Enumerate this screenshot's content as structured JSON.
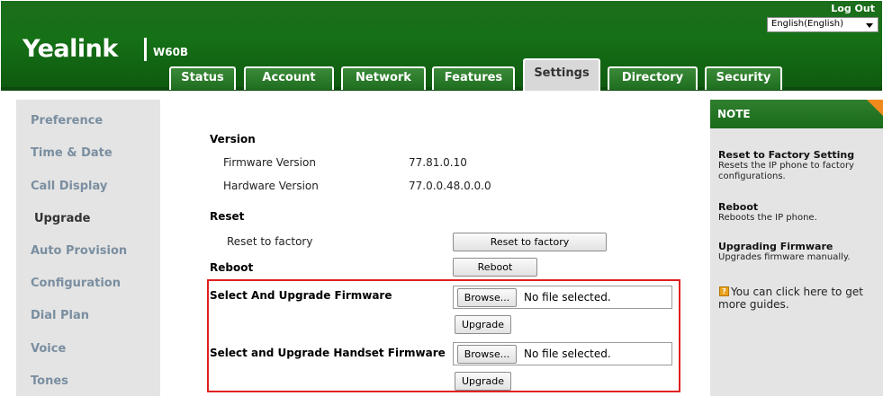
{
  "header": {
    "logo": "Yealink",
    "model": "W60B",
    "logout": "Log Out",
    "language": "English(English)"
  },
  "tabs": [
    {
      "label": "Status"
    },
    {
      "label": "Account"
    },
    {
      "label": "Network"
    },
    {
      "label": "Features"
    },
    {
      "label": "Settings"
    },
    {
      "label": "Directory"
    },
    {
      "label": "Security"
    }
  ],
  "active_tab": "Settings",
  "sidebar": {
    "items": [
      {
        "label": "Preference"
      },
      {
        "label": "Time & Date"
      },
      {
        "label": "Call Display"
      },
      {
        "label": "Upgrade"
      },
      {
        "label": "Auto Provision"
      },
      {
        "label": "Configuration"
      },
      {
        "label": "Dial Plan"
      },
      {
        "label": "Voice"
      },
      {
        "label": "Tones"
      }
    ],
    "active": "Upgrade"
  },
  "main": {
    "version_title": "Version",
    "firmware_label": "Firmware Version",
    "firmware_value": "77.81.0.10",
    "hardware_label": "Hardware Version",
    "hardware_value": "77.0.0.48.0.0.0",
    "reset_title": "Reset",
    "reset_label": "Reset to factory",
    "reset_button": "Reset to factory",
    "reboot_title": "Reboot",
    "reboot_button": "Reboot",
    "fw_title": "Select And Upgrade Firmware",
    "fw_browse": "Browse...",
    "fw_file": "No file selected.",
    "fw_upgrade": "Upgrade",
    "hs_title": "Select and Upgrade Handset Firmware",
    "hs_browse": "Browse...",
    "hs_file": "No file selected.",
    "hs_upgrade": "Upgrade"
  },
  "note": {
    "title": "NOTE",
    "items": [
      {
        "title": "Reset to Factory Setting",
        "text": "Resets the IP phone to factory configurations."
      },
      {
        "title": "Reboot",
        "text": "Reboots the IP phone."
      },
      {
        "title": "Upgrading Firmware",
        "text": "Upgrades firmware manually."
      }
    ],
    "guide": "You can click here to get more guides."
  },
  "colors": {
    "header_green": "#157016",
    "highlight_red": "#e02020",
    "note_corner": "#f08a1c"
  }
}
